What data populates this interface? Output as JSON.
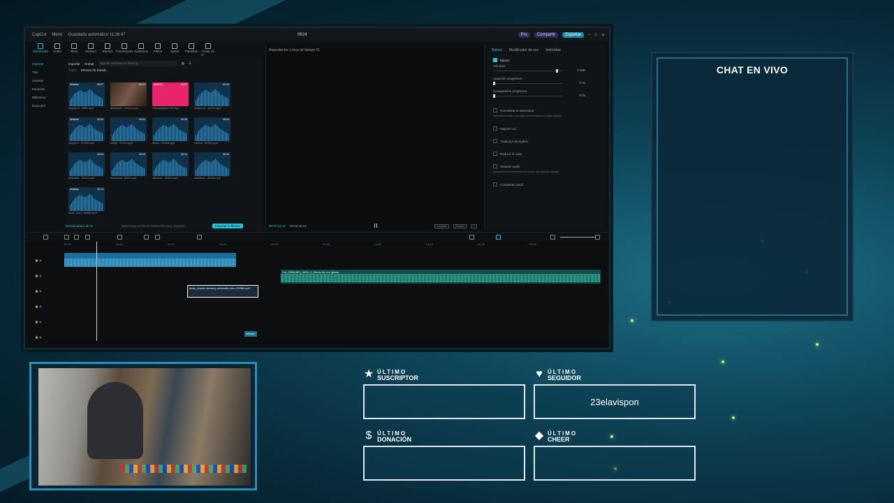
{
  "overlay": {
    "chat_title": "CHAT EN VIVO",
    "labels": [
      {
        "top": "ÚLTIMO",
        "bottom": "SUSCRIPTOR",
        "icon": "star-icon",
        "glyph": "★",
        "value": ""
      },
      {
        "top": "ÚLTIMO",
        "bottom": "SEGUIDOR",
        "icon": "heart-icon",
        "glyph": "♥",
        "value": "23elavispon"
      },
      {
        "top": "ÚLTIMO",
        "bottom": "DONACIÓN",
        "icon": "dollar-icon",
        "glyph": "$",
        "value": ""
      },
      {
        "top": "ÚLTIMO",
        "bottom": "CHEER",
        "icon": "diamond-icon",
        "glyph": "◆",
        "value": ""
      }
    ],
    "colors": {
      "accent": "#23c7d9",
      "panel_border": "#2a6f86",
      "sparkle": "#c6e86a"
    }
  },
  "editor": {
    "app": "CapCut",
    "menu": "Menú",
    "project": "Guardado automático 11:26:47",
    "window_title": "0624",
    "pro_badge": "Pro",
    "share_label": "Compartir",
    "export_label": "Exportar",
    "toolbar": [
      {
        "label": "Multimedia",
        "icon": "media-icon"
      },
      {
        "label": "Audio",
        "icon": "audio-icon"
      },
      {
        "label": "Texto",
        "icon": "text-icon"
      },
      {
        "label": "Stickers",
        "icon": "sticker-icon"
      },
      {
        "label": "Efectos",
        "icon": "effects-icon"
      },
      {
        "label": "Transiciones",
        "icon": "transitions-icon"
      },
      {
        "label": "Subtítulos",
        "icon": "subtitles-icon"
      },
      {
        "label": "Filtros",
        "icon": "filter-icon"
      },
      {
        "label": "Ajuste",
        "icon": "adjust-icon"
      },
      {
        "label": "Plantillas",
        "icon": "template-icon"
      },
      {
        "label": "Avatar de IA",
        "icon": "avatar-icon"
      }
    ],
    "sidebar": [
      "Importar",
      "Tipo",
      "Generar",
      "Espacios",
      "Biblioteca",
      "Descubrir"
    ],
    "media": {
      "import_label": "Importar",
      "record_label": "Grabar",
      "search_placeholder": "Buscar archivos en librería",
      "tabs": [
        "Todos",
        "Efectos de Sonido"
      ],
      "items": [
        {
          "name": "dragon-ui...9650.mp3",
          "badge": "Añadido",
          "dur": "00:07",
          "kind": "wave"
        },
        {
          "name": "descargar...rucbos.mp4",
          "badge": "",
          "dur": "00:03",
          "kind": "photo"
        },
        {
          "name": "videoplayback (9).mp4",
          "badge": "Añadido",
          "dur": "00:03",
          "kind": "pink"
        },
        {
          "name": "dragon-ui...a4199.mp3",
          "badge": "",
          "dur": "00:03",
          "kind": "wave"
        },
        {
          "name": "dungeon...37193.mp3",
          "badge": "Añadido",
          "dur": "00:04",
          "kind": "wave"
        },
        {
          "name": "dibujo...37653.mp3",
          "badge": "",
          "dur": "00:04",
          "kind": "wave"
        },
        {
          "name": "dibujo...37658.mp3",
          "badge": "",
          "dur": "00:05",
          "kind": "wave"
        },
        {
          "name": "natural...22442.mp3",
          "badge": "",
          "dur": "00:04",
          "kind": "wave"
        },
        {
          "name": "unlimited...20013.mp3",
          "badge": "",
          "dur": "00:03",
          "kind": "wave"
        },
        {
          "name": "freesound...6299.mp3",
          "badge": "",
          "dur": "00:03",
          "kind": "wave"
        },
        {
          "name": "ldsearch...40904.mp3",
          "badge": "",
          "dur": "00:04",
          "kind": "wave"
        },
        {
          "name": "seashore...40418.mp3",
          "badge": "",
          "dur": "00:03",
          "kind": "wave"
        },
        {
          "name": "block_hum...28958.mp3",
          "badge": "Añadido",
          "dur": "00:14",
          "kind": "wave"
        }
      ],
      "footer_ai": "Remarcadora de IA",
      "footer_hint": "Selecciona archivos multimedia para importar",
      "footer_btn": "Importar a librería"
    },
    "player": {
      "title": "Reproductor: Línea de tiempo 01",
      "current": "00:00:12:16",
      "total": "00:25:46:16",
      "btn_full": "Completo",
      "btn_ratio": "Relación"
    },
    "props": {
      "tabs": [
        "Básico",
        "Modificador de voz",
        "Velocidad"
      ],
      "section": "Básico",
      "rows": [
        {
          "label": "Volumen",
          "value": "0.0dB",
          "pos": 0.9
        },
        {
          "label": "Aparición progresiva",
          "value": "0.0s",
          "pos": 0.0
        },
        {
          "label": "Desaparición progresiva",
          "value": "0.0s",
          "pos": 0.0
        }
      ],
      "options": [
        {
          "label": "Normalizar la intensidad",
          "desc": "Normaliza el clip o los clips seleccionados al valor objetivo."
        },
        {
          "label": "Mejorar voz",
          "desc": ""
        },
        {
          "label": "Traductor de audios",
          "desc": ""
        },
        {
          "label": "Reducir el ruido",
          "desc": ""
        },
        {
          "label": "Separar audio",
          "desc": "Selecciona los elementos del audio que quieras separar."
        },
        {
          "label": "Completar canal",
          "desc": ""
        }
      ]
    },
    "timeline": {
      "ruler": [
        "00:00",
        "00:10",
        "00:20",
        "00:30",
        "00:40",
        "00:50",
        "01:00",
        "01:10",
        "01:20",
        "01:30"
      ],
      "clips": {
        "green": "Cut_2024(487)_0633_0_Efecto de voz iglesia",
        "white": "block_bcmnb-dreamy-cinematic-hum-22958.mp3",
        "small": "wikicpe"
      }
    }
  }
}
